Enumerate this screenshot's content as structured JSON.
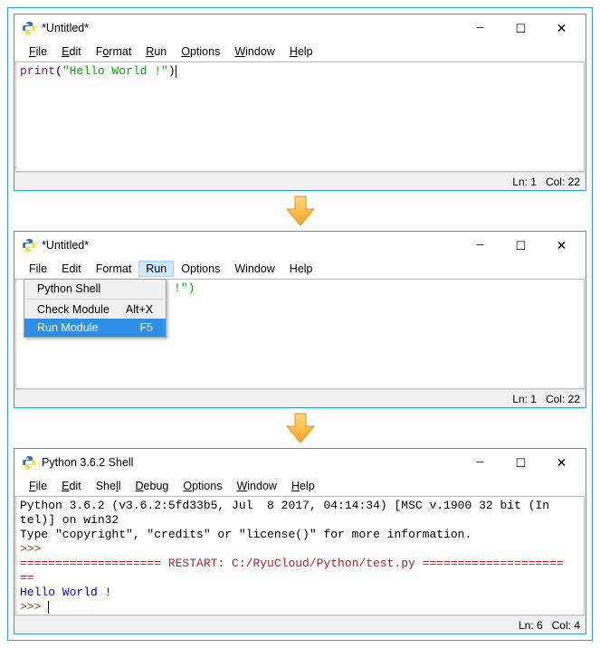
{
  "win1": {
    "title": "*Untitled*",
    "menus": [
      "File",
      "Edit",
      "Format",
      "Run",
      "Options",
      "Window",
      "Help"
    ],
    "code": {
      "kw": "print",
      "open": "(",
      "str": "\"Hello World !\"",
      "close": ")"
    },
    "status": {
      "ln": "Ln: 1",
      "col": "Col: 22"
    }
  },
  "win2": {
    "title": "*Untitled*",
    "menus": [
      "File",
      "Edit",
      "Format",
      "Run",
      "Options",
      "Window",
      "Help"
    ],
    "dropdown": {
      "item0": {
        "label": "Python Shell",
        "accel": ""
      },
      "item1": {
        "label": "Check Module",
        "accel": "Alt+X"
      },
      "item2": {
        "label": "Run Module",
        "accel": "F5"
      }
    },
    "partial": "!\")",
    "status": {
      "ln": "Ln: 1",
      "col": "Col: 22"
    }
  },
  "win3": {
    "title": "Python 3.6.2 Shell",
    "menus": [
      "File",
      "Edit",
      "Shell",
      "Debug",
      "Options",
      "Window",
      "Help"
    ],
    "banner1": "Python 3.6.2 (v3.6.2:5fd33b5, Jul  8 2017, 04:14:34) [MSC v.1900 32 bit (In",
    "banner2": "tel)] on win32",
    "banner3": "Type \"copyright\", \"credits\" or \"license()\" for more information.",
    "prompt": ">>> ",
    "restart": "==================== RESTART: C:/RyuCloud/Python/test.py ====================",
    "restart2": "==",
    "output": "Hello World !",
    "status": {
      "ln": "Ln: 6",
      "col": "Col: 4"
    }
  },
  "winbtns": {
    "min": "—",
    "max": "☐",
    "close": "✕"
  }
}
